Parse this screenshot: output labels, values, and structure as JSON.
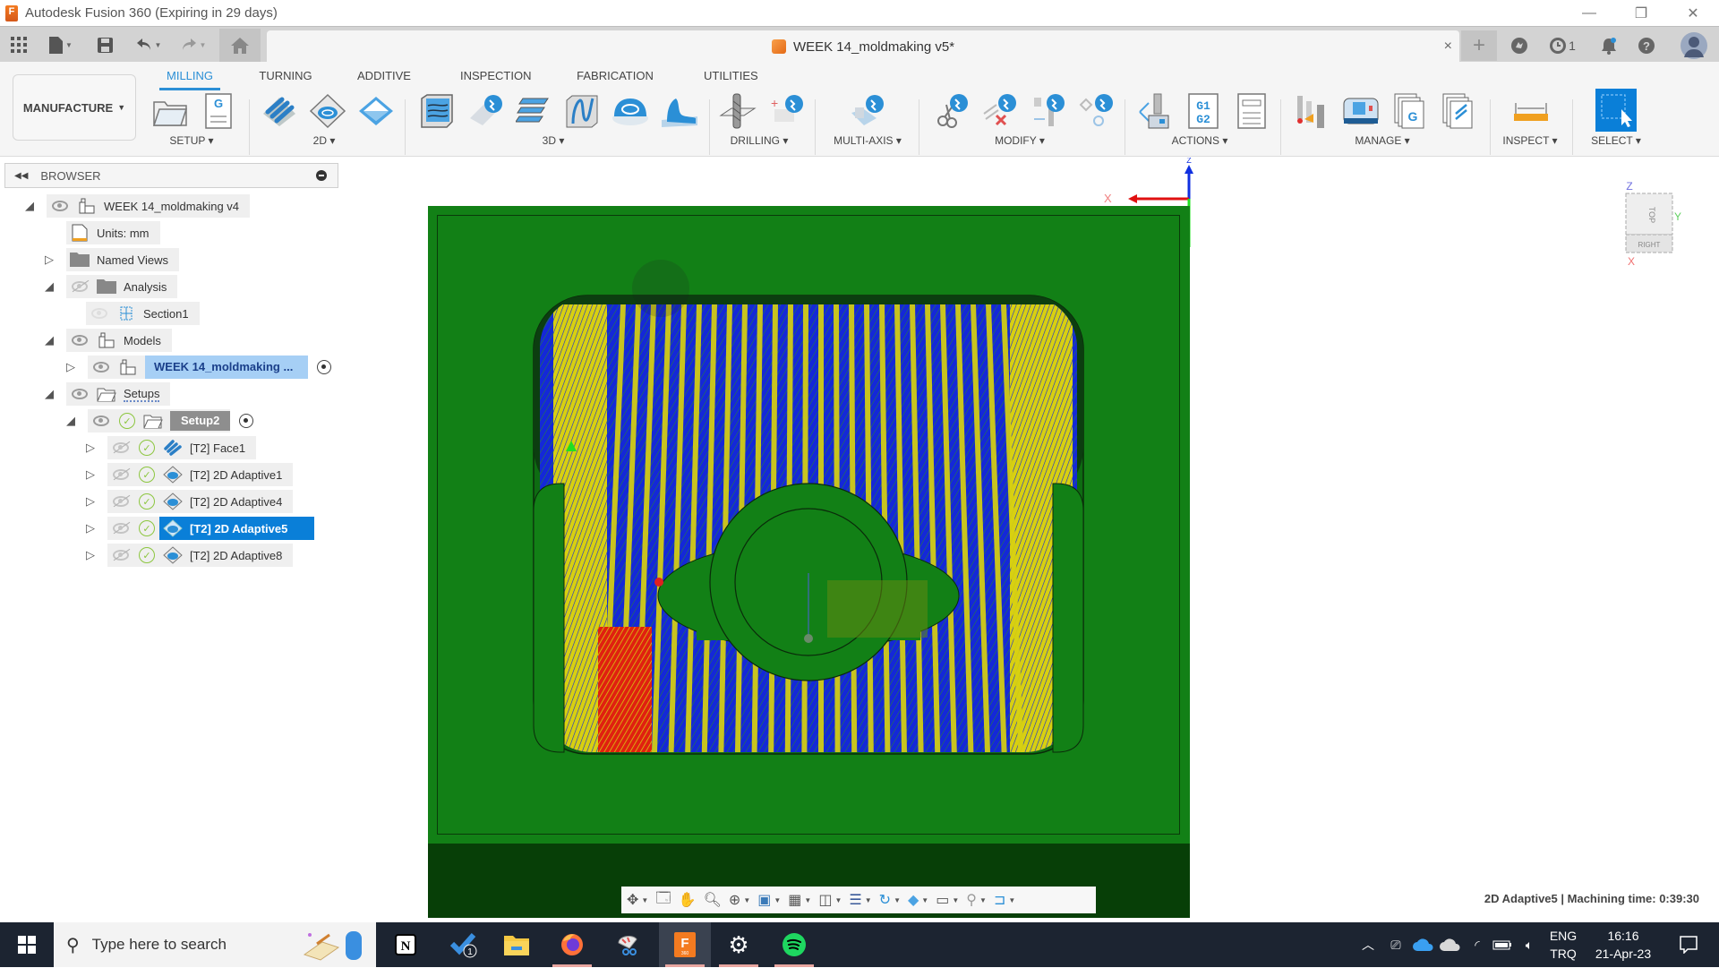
{
  "window": {
    "title": "Autodesk Fusion 360 (Expiring in 29 days)",
    "minimize": "—",
    "restore": "❐",
    "close": "✕"
  },
  "quick_access": {
    "data_panel_icon": "grid-icon",
    "file_icon": "file-icon",
    "save_icon": "save-icon",
    "undo_icon": "undo-icon",
    "redo_icon": "redo-icon",
    "home_icon": "home-icon"
  },
  "document": {
    "title": "WEEK 14_moldmaking v5*",
    "close": "×"
  },
  "header_right": {
    "new_tab": "+",
    "job_status_count": "1"
  },
  "ribbon": {
    "workspace": "MANUFACTURE",
    "tabs": [
      {
        "label": "MILLING",
        "active": true
      },
      {
        "label": "TURNING",
        "active": false
      },
      {
        "label": "ADDITIVE",
        "active": false
      },
      {
        "label": "INSPECTION",
        "active": false
      },
      {
        "label": "FABRICATION",
        "active": false
      },
      {
        "label": "UTILITIES",
        "active": false
      }
    ],
    "groups": [
      {
        "label": "SETUP"
      },
      {
        "label": "2D"
      },
      {
        "label": "3D"
      },
      {
        "label": "DRILLING"
      },
      {
        "label": "MULTI-AXIS"
      },
      {
        "label": "MODIFY"
      },
      {
        "label": "ACTIONS"
      },
      {
        "label": "MANAGE"
      },
      {
        "label": "INSPECT"
      },
      {
        "label": "SELECT"
      }
    ],
    "actions_g_text": "G1\nG2",
    "g_letter": "G"
  },
  "browser": {
    "title": "BROWSER",
    "items": [
      {
        "label": "WEEK 14_moldmaking v4"
      },
      {
        "label": "Units: mm"
      },
      {
        "label": "Named Views"
      },
      {
        "label": "Analysis"
      },
      {
        "label": "Section1"
      },
      {
        "label": "Models"
      },
      {
        "label": "WEEK 14_moldmaking ..."
      },
      {
        "label": "Setups"
      },
      {
        "label": "Setup2"
      },
      {
        "label": "[T2] Face1"
      },
      {
        "label": "[T2] 2D Adaptive1"
      },
      {
        "label": "[T2] 2D Adaptive4"
      },
      {
        "label": "[T2] 2D Adaptive5",
        "selected": true
      },
      {
        "label": "[T2] 2D Adaptive8"
      }
    ]
  },
  "viewcube": {
    "top": "TOP",
    "right": "RIGHT",
    "z": "Z",
    "y": "Y",
    "x": "X"
  },
  "triad": {
    "x_label": "X",
    "z_label": "Z"
  },
  "status": {
    "text": "2D Adaptive5 | Machining time: 0:39:30"
  },
  "taskbar": {
    "search_placeholder": "Type here to search",
    "lang_top": "ENG",
    "lang_bottom": "TRQ",
    "time": "16:16",
    "date": "21-Apr-23",
    "todo_badge": "1",
    "apps": [
      "notion",
      "todo",
      "file-explorer",
      "firefox",
      "snip-sketch",
      "fusion-360",
      "settings",
      "spotify"
    ]
  },
  "colors": {
    "accent": "#2b8fd6",
    "stock_green": "#128016",
    "toolpath_blue": "#1428d8",
    "toolpath_yellow": "#d8d010",
    "toolpath_red": "#e02010",
    "selection": "#0a7fd8"
  }
}
